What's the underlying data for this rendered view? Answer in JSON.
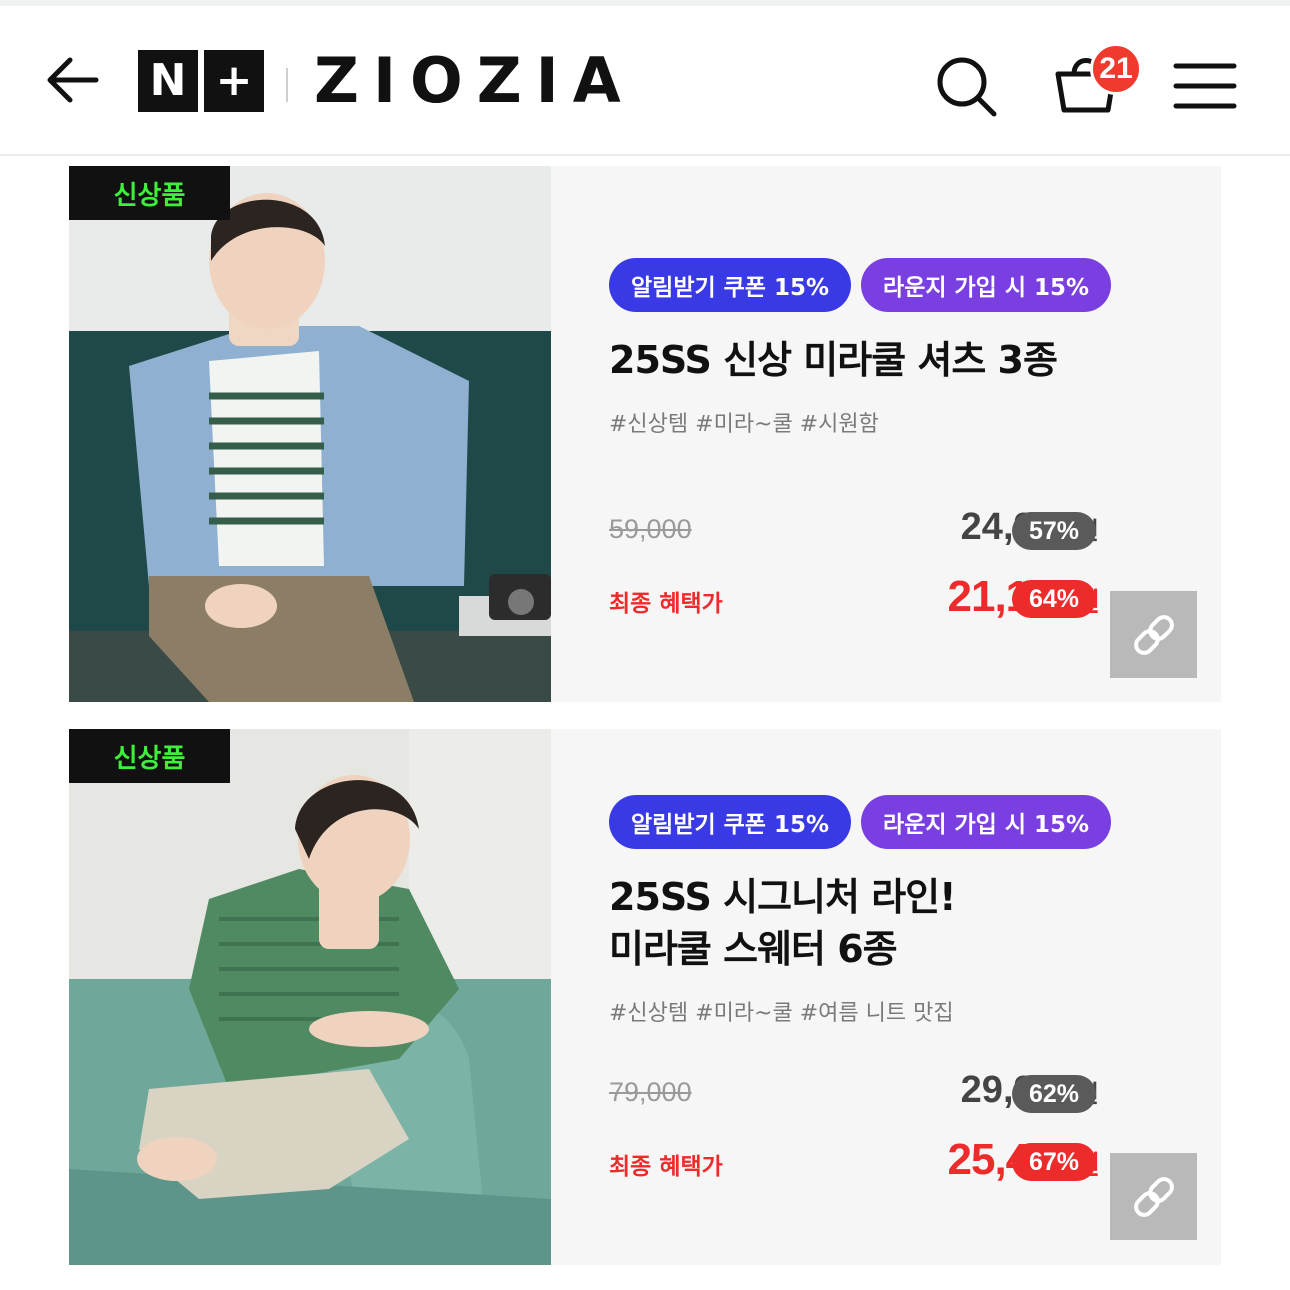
{
  "header": {
    "badge_n": "N",
    "badge_plus": "+",
    "brand": "ZIOZIA",
    "cart_count": "21",
    "icons": [
      "back-arrow-icon",
      "search-icon",
      "cart-icon",
      "hamburger-menu-icon"
    ]
  },
  "products": [
    {
      "badge": "신상품",
      "chips": [
        "알림받기 쿠폰 15%",
        "라운지 가입 시 15%"
      ],
      "title_lines": [
        "25SS 신상 미라쿨 셔츠 3종"
      ],
      "tags": "#신상템 #미라~쿨 #시원함",
      "original_price": "59,000",
      "sale_price": "24,900",
      "sale_unit": "원",
      "sale_discount": "57%",
      "final_label": "최종 혜택가",
      "final_price": "21,160",
      "final_unit": "원",
      "final_discount": "64%",
      "link_icon": "link-icon"
    },
    {
      "badge": "신상품",
      "chips": [
        "알림받기 쿠폰 15%",
        "라운지 가입 시 15%"
      ],
      "title_lines": [
        "25SS 시그니처 라인!",
        "미라쿨 스웨터 6종"
      ],
      "tags": "#신상템 #미라~쿨 #여름 니트 맛집",
      "original_price": "79,000",
      "sale_price": "29,900",
      "sale_unit": "원",
      "sale_discount": "62%",
      "final_label": "최종 혜택가",
      "final_price": "25,410",
      "final_unit": "원",
      "final_discount": "67%",
      "link_icon": "link-icon"
    }
  ],
  "colors": {
    "chip_blue": "#3a39e6",
    "chip_purple": "#7a3fe0",
    "price_red": "#ee2b2b",
    "new_badge_text": "#3df03a",
    "cart_badge": "#f03a2e"
  }
}
